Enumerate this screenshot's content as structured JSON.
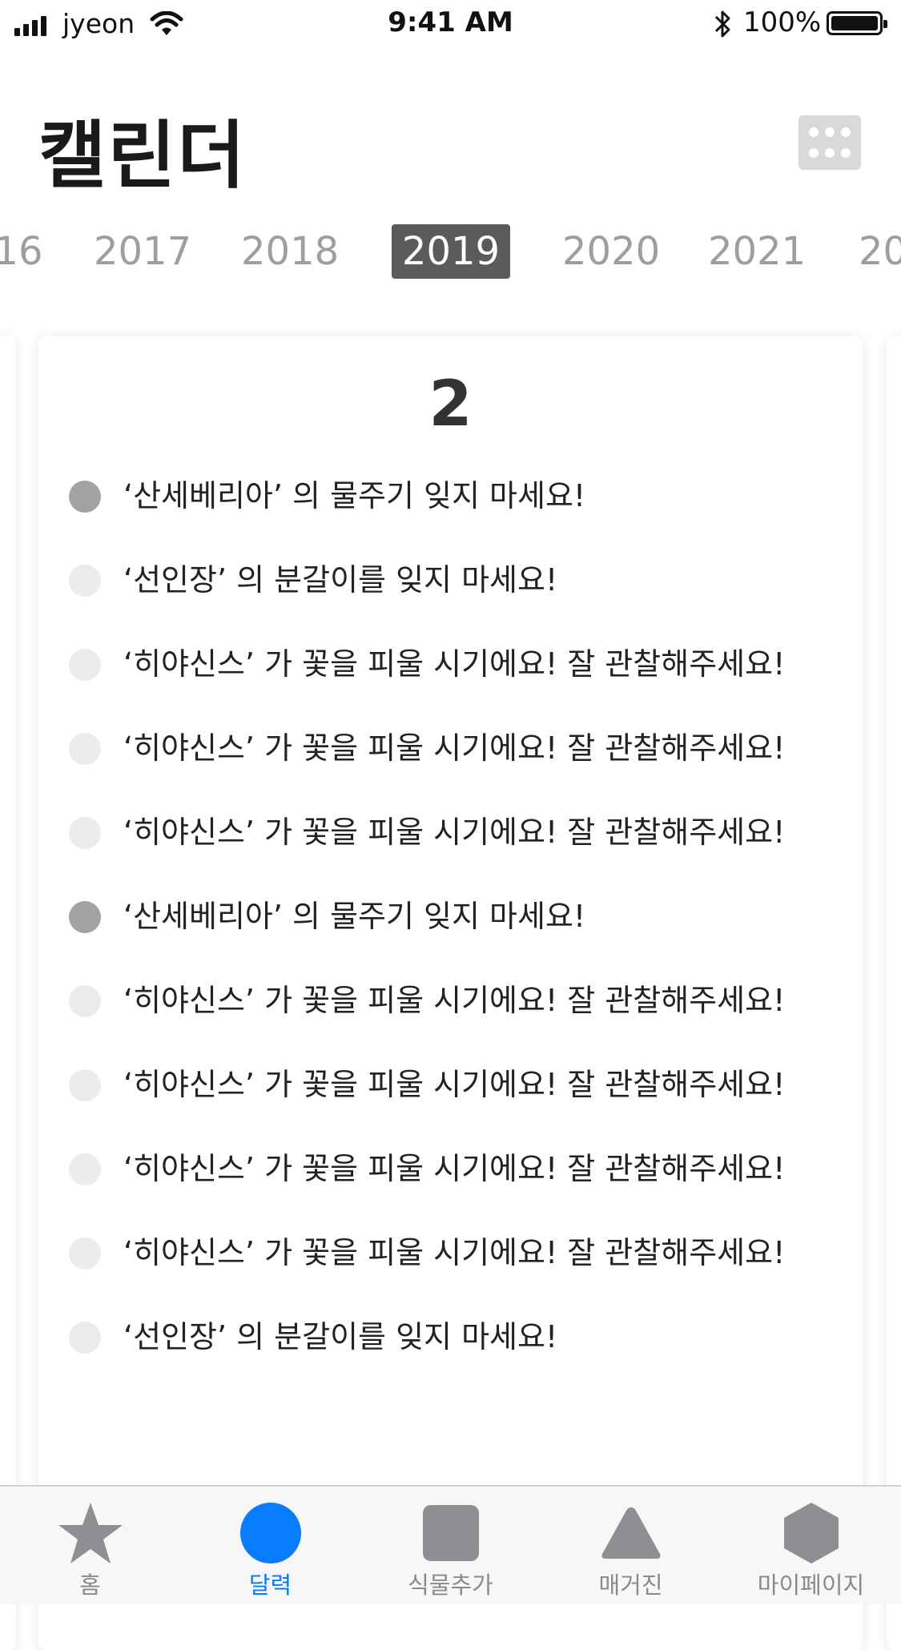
{
  "status_bar": {
    "carrier": "jyeon",
    "time": "9:41 AM",
    "battery_percent": "100%",
    "icons": [
      "signal-icon",
      "wifi-icon",
      "bluetooth-icon",
      "battery-icon"
    ]
  },
  "header": {
    "title": "캘린더",
    "grid_icon": "grid-icon"
  },
  "years": {
    "items": [
      "16",
      "2017",
      "2018",
      "2019",
      "2020",
      "2021",
      "20"
    ],
    "selected": "2019"
  },
  "calendar": {
    "month": "2",
    "events": [
      {
        "text": "‘산세베리아’ 의 물주기 잊지 마세요!",
        "highlighted": true
      },
      {
        "text": "‘선인장’ 의 분갈이를 잊지 마세요!",
        "highlighted": false
      },
      {
        "text": "‘히야신스’ 가 꽃을 피울 시기에요! 잘 관찰해주세요!",
        "highlighted": false
      },
      {
        "text": "‘히야신스’ 가 꽃을 피울 시기에요! 잘 관찰해주세요!",
        "highlighted": false
      },
      {
        "text": "‘히야신스’ 가 꽃을 피울 시기에요! 잘 관찰해주세요!",
        "highlighted": false
      },
      {
        "text": "‘산세베리아’ 의 물주기 잊지 마세요!",
        "highlighted": true
      },
      {
        "text": "‘히야신스’ 가 꽃을 피울 시기에요! 잘 관찰해주세요!",
        "highlighted": false
      },
      {
        "text": "‘히야신스’ 가 꽃을 피울 시기에요! 잘 관찰해주세요!",
        "highlighted": false
      },
      {
        "text": "‘히야신스’ 가 꽃을 피울 시기에요! 잘 관찰해주세요!",
        "highlighted": false
      },
      {
        "text": "‘히야신스’ 가 꽃을 피울 시기에요! 잘 관찰해주세요!",
        "highlighted": false
      },
      {
        "text": "‘선인장’ 의 분갈이를 잊지 마세요!",
        "highlighted": false
      }
    ]
  },
  "tab_bar": {
    "tabs": [
      {
        "label": "홈",
        "icon": "star-icon"
      },
      {
        "label": "달력",
        "icon": "circle-icon"
      },
      {
        "label": "식물추가",
        "icon": "square-icon"
      },
      {
        "label": "매거진",
        "icon": "triangle-icon"
      },
      {
        "label": "마이페이지",
        "icon": "hexagon-icon"
      }
    ],
    "active": "달력"
  },
  "colors": {
    "accent": "#0a7cff",
    "selected_year_bg": "#5b5b5b",
    "dot_highlight": "#a3a3a3",
    "dot_default": "#ececec",
    "tab_icon": "#8e8e93"
  }
}
